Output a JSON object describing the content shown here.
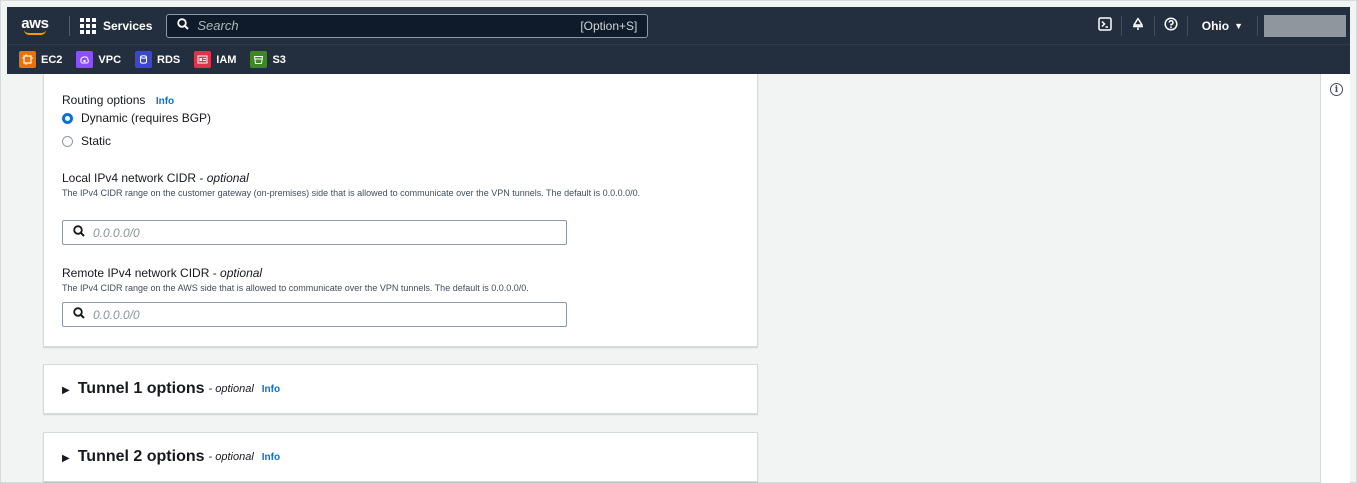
{
  "topnav": {
    "logo_text": "aws",
    "services_label": "Services",
    "search_placeholder": "Search",
    "search_shortcut": "[Option+S]",
    "region_label": "Ohio",
    "icons": [
      "cloudshell-icon",
      "bell-icon",
      "help-icon"
    ]
  },
  "favorites": [
    {
      "label": "EC2",
      "icon": "ec2-icon",
      "color": "#ed7100"
    },
    {
      "label": "VPC",
      "icon": "vpc-icon",
      "color": "#8c4fff"
    },
    {
      "label": "RDS",
      "icon": "rds-icon",
      "color": "#3b48cc"
    },
    {
      "label": "IAM",
      "icon": "iam-icon",
      "color": "#dd344c"
    },
    {
      "label": "S3",
      "icon": "s3-icon",
      "color": "#3f8624"
    }
  ],
  "routing": {
    "label": "Routing options",
    "info": "Info",
    "options": [
      {
        "label": "Dynamic (requires BGP)",
        "checked": true
      },
      {
        "label": "Static",
        "checked": false
      }
    ]
  },
  "local_cidr": {
    "label": "Local IPv4 network CIDR - ",
    "optional": "optional",
    "description": "The IPv4 CIDR range on the customer gateway (on-premises) side that is allowed to communicate over the VPN tunnels. The default is 0.0.0.0/0.",
    "placeholder": "0.0.0.0/0"
  },
  "remote_cidr": {
    "label": "Remote IPv4 network CIDR - ",
    "optional": "optional",
    "description": "The IPv4 CIDR range on the AWS side that is allowed to communicate over the VPN tunnels. The default is 0.0.0.0/0.",
    "placeholder": "0.0.0.0/0"
  },
  "tunnels": [
    {
      "title": "Tunnel 1 options",
      "optional": "- optional",
      "info": "Info"
    },
    {
      "title": "Tunnel 2 options",
      "optional": "- optional",
      "info": "Info"
    }
  ],
  "colors": {
    "nav_bg": "#232f3e",
    "link": "#0972d3",
    "page_bg": "#f2f3f3"
  }
}
